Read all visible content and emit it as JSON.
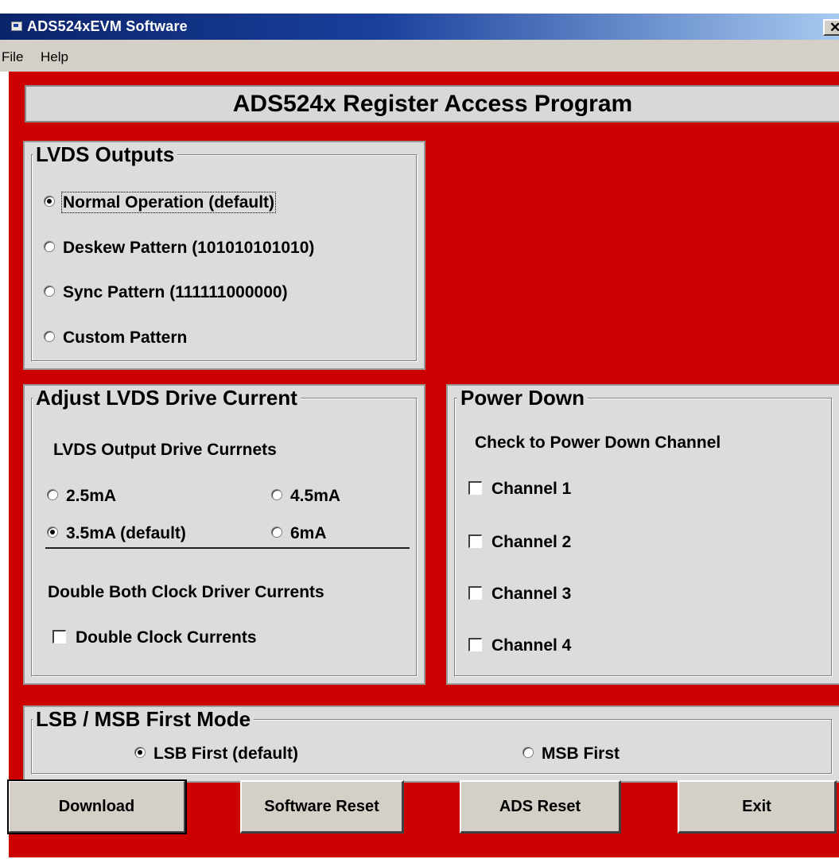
{
  "window": {
    "title": "ADS524xEVM Software",
    "close_glyph": "✕"
  },
  "menu": {
    "items": [
      "File",
      "Help"
    ]
  },
  "colors": {
    "background": "#cc0000",
    "panel": "#dcdcdc"
  },
  "banner": {
    "title": "ADS524x Register Access Program"
  },
  "lvds_outputs": {
    "title": "LVDS Outputs",
    "options": [
      {
        "label": "Normal Operation (default)",
        "checked": true
      },
      {
        "label": "Deskew Pattern  (101010101010)",
        "checked": false
      },
      {
        "label": "Sync Pattern  (111111000000)",
        "checked": false
      },
      {
        "label": "Custom Pattern",
        "checked": false
      }
    ]
  },
  "drive_current": {
    "title": "Adjust LVDS Drive Current",
    "subtitle": "LVDS Output Drive Currnets",
    "options": [
      {
        "label": "2.5mA",
        "checked": false
      },
      {
        "label": "4.5mA",
        "checked": false
      },
      {
        "label": "3.5mA (default)",
        "checked": true
      },
      {
        "label": "6mA",
        "checked": false
      }
    ],
    "double_heading": "Double Both Clock Driver Currents",
    "double_checkbox": {
      "label": "Double Clock Currents",
      "checked": false
    }
  },
  "power_down": {
    "title": "Power Down",
    "subtitle": "Check to Power Down Channel",
    "channels": [
      {
        "label": "Channel 1",
        "checked": false
      },
      {
        "label": "Channel 2",
        "checked": false
      },
      {
        "label": "Channel 3",
        "checked": false
      },
      {
        "label": "Channel 4",
        "checked": false
      }
    ]
  },
  "first_mode": {
    "title": "LSB / MSB First Mode",
    "options": [
      {
        "label": "LSB First (default)",
        "checked": true
      },
      {
        "label": "MSB First",
        "checked": false
      }
    ]
  },
  "buttons": {
    "download": "Download",
    "software_reset": "Software Reset",
    "ads_reset": "ADS Reset",
    "exit": "Exit"
  }
}
